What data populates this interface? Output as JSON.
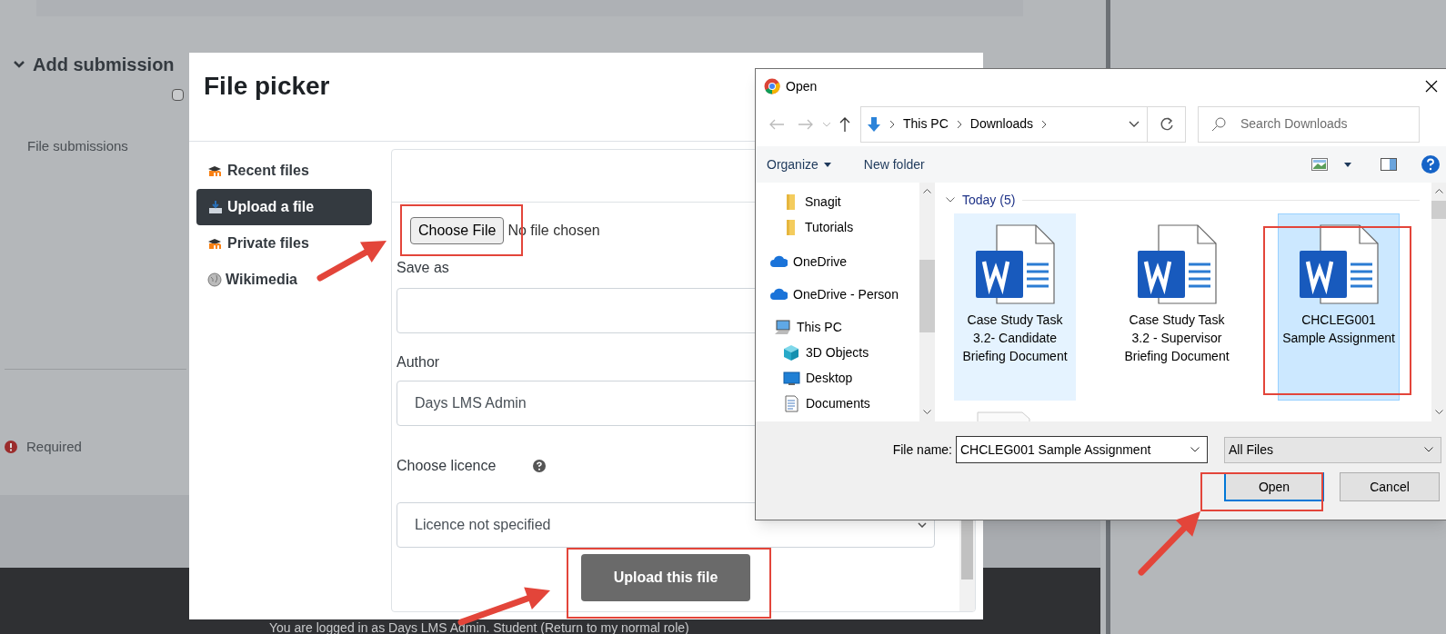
{
  "page": {
    "section_title": "Add submission",
    "checkbox_checked": false,
    "field_label": "File submissions",
    "required_label": "Required",
    "footer_text": "You are logged in as Days LMS Admin. Student (Return to my normal role)"
  },
  "file_picker": {
    "title": "File picker",
    "repositories": [
      {
        "label": "Recent files",
        "kind": "moodle",
        "selected": false
      },
      {
        "label": "Upload a file",
        "kind": "upload",
        "selected": true
      },
      {
        "label": "Private files",
        "kind": "moodle",
        "selected": false
      },
      {
        "label": "Wikimedia",
        "kind": "globe",
        "selected": false
      }
    ],
    "choose_button": "Choose File",
    "no_file": "No file chosen",
    "save_as_label": "Save as",
    "author_label": "Author",
    "author_value": "Days LMS Admin",
    "licence_label": "Choose licence",
    "licence_value": "Licence not specified",
    "upload_button": "Upload this file"
  },
  "open_dialog": {
    "title": "Open",
    "path": [
      "This PC",
      "Downloads"
    ],
    "search_placeholder": "Search Downloads",
    "organize": "Organize",
    "new_folder": "New folder",
    "nav_items": [
      {
        "label": "Snagit",
        "kind": "folder"
      },
      {
        "label": "Tutorials",
        "kind": "folder"
      },
      {
        "label": "OneDrive",
        "kind": "cloud"
      },
      {
        "label": "OneDrive - Person",
        "kind": "cloud"
      },
      {
        "label": "This PC",
        "kind": "pc"
      },
      {
        "label": "3D Objects",
        "kind": "cube"
      },
      {
        "label": "Desktop",
        "kind": "desktop"
      },
      {
        "label": "Documents",
        "kind": "documents"
      }
    ],
    "group_label": "Today (5)",
    "files": [
      {
        "name": "Case Study Task 3.2- Candidate Briefing Document",
        "hovered": true,
        "selected": false
      },
      {
        "name": "Case Study Task 3.2 - Supervisor Briefing Document",
        "hovered": false,
        "selected": false
      },
      {
        "name": "CHCLEG001 Sample Assignment",
        "hovered": true,
        "selected": true
      }
    ],
    "file_name_label": "File name:",
    "file_name_value": "CHCLEG001 Sample Assignment",
    "file_type": "All Files",
    "buttons": [
      {
        "label": "Open",
        "default": true
      },
      {
        "label": "Cancel",
        "default": false
      }
    ]
  }
}
